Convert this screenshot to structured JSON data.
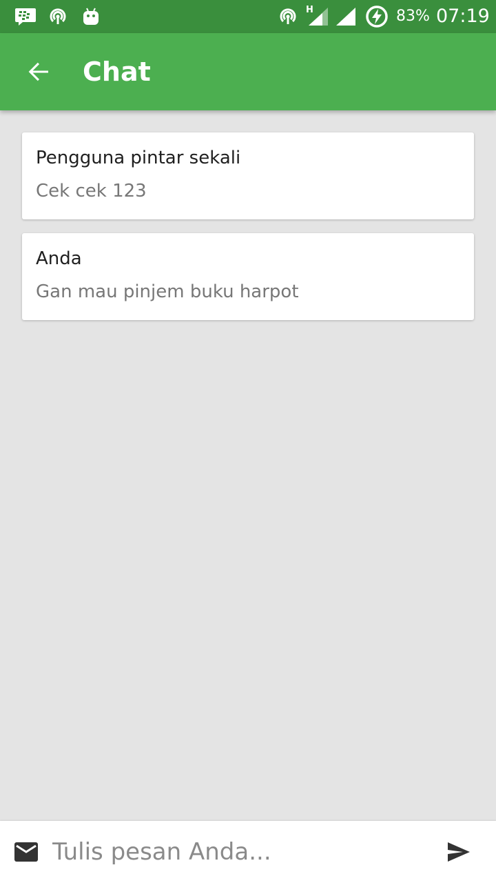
{
  "status_bar": {
    "battery": "83%",
    "time": "07:19",
    "network_type": "H",
    "icons": [
      "bbm-icon",
      "hotspot-icon",
      "android-icon",
      "hotspot-icon",
      "signal-icon",
      "signal-icon",
      "battery-charging-icon"
    ]
  },
  "app_bar": {
    "title": "Chat",
    "back_icon": "arrow-back-icon"
  },
  "messages": [
    {
      "sender": "Pengguna pintar sekali",
      "text": "Cek cek 123"
    },
    {
      "sender": "Anda",
      "text": "Gan mau pinjem buku harpot"
    }
  ],
  "composer": {
    "placeholder": "Tulis pesan Anda...",
    "value": "",
    "mail_icon": "mail-icon",
    "send_icon": "send-icon"
  },
  "colors": {
    "status_bar": "#3a8f3d",
    "app_bar": "#4caf50",
    "background": "#e4e4e4",
    "card": "#ffffff",
    "sender_text": "#1f1f1f",
    "message_text": "#777777"
  }
}
